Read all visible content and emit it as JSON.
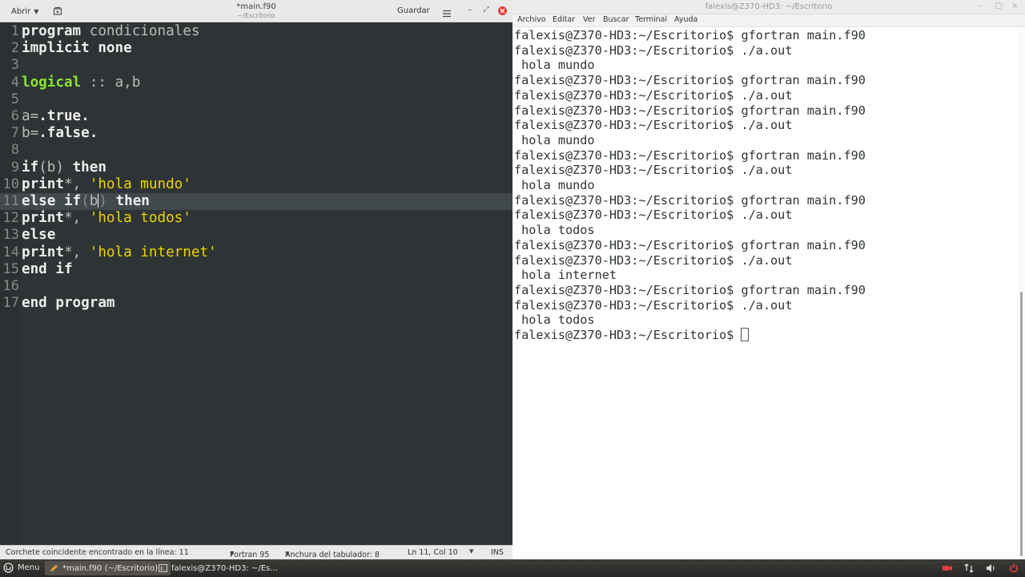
{
  "editor": {
    "open_label": "Abrir",
    "title": "*main.f90",
    "subtitle": "~/Escritorio",
    "save_label": "Guardar",
    "code_lines": [
      {
        "num": "1",
        "tokens": [
          {
            "t": "program",
            "c": "kw"
          },
          {
            "t": " condicionales",
            "c": "dim"
          }
        ]
      },
      {
        "num": "2",
        "tokens": [
          {
            "t": "implicit none",
            "c": "kw"
          }
        ]
      },
      {
        "num": "3",
        "tokens": []
      },
      {
        "num": "4",
        "tokens": [
          {
            "t": "logical",
            "c": "typ"
          },
          {
            "t": " :: a,b",
            "c": "dim"
          }
        ]
      },
      {
        "num": "5",
        "tokens": []
      },
      {
        "num": "6",
        "tokens": [
          {
            "t": "a=",
            "c": "dim"
          },
          {
            "t": ".true.",
            "c": "kw"
          }
        ]
      },
      {
        "num": "7",
        "tokens": [
          {
            "t": "b=",
            "c": "dim"
          },
          {
            "t": ".false.",
            "c": "kw"
          }
        ]
      },
      {
        "num": "8",
        "tokens": []
      },
      {
        "num": "9",
        "tokens": [
          {
            "t": "if",
            "c": "kw"
          },
          {
            "t": "(b) ",
            "c": "dim"
          },
          {
            "t": "then",
            "c": "kw"
          }
        ]
      },
      {
        "num": "10",
        "tokens": [
          {
            "t": "print",
            "c": "kw"
          },
          {
            "t": "*, ",
            "c": "dim"
          },
          {
            "t": "'hola mundo'",
            "c": "str"
          }
        ]
      },
      {
        "num": "11",
        "current": true,
        "tokens": [
          {
            "t": "else if",
            "c": "kw"
          },
          {
            "t": "(",
            "c": "paren"
          },
          {
            "t": "b",
            "c": "dim"
          },
          {
            "t": "CARET",
            "c": "caret"
          },
          {
            "t": ")",
            "c": "paren"
          },
          {
            "t": " ",
            "c": "dim"
          },
          {
            "t": "then",
            "c": "kw"
          }
        ]
      },
      {
        "num": "12",
        "tokens": [
          {
            "t": "print",
            "c": "kw"
          },
          {
            "t": "*, ",
            "c": "dim"
          },
          {
            "t": "'hola todos'",
            "c": "str"
          }
        ]
      },
      {
        "num": "13",
        "tokens": [
          {
            "t": "else",
            "c": "kw"
          }
        ]
      },
      {
        "num": "14",
        "tokens": [
          {
            "t": "print",
            "c": "kw"
          },
          {
            "t": "*, ",
            "c": "dim"
          },
          {
            "t": "'hola internet'",
            "c": "str"
          }
        ]
      },
      {
        "num": "15",
        "tokens": [
          {
            "t": "end if",
            "c": "kw"
          }
        ]
      },
      {
        "num": "16",
        "tokens": []
      },
      {
        "num": "17",
        "tokens": [
          {
            "t": "end program",
            "c": "kw"
          }
        ]
      }
    ],
    "status": {
      "message": "Corchete coincidente encontrado en la línea: 11",
      "language": "Fortran 95",
      "tab_width": "Anchura del tabulador: 8",
      "position": "Ln 11, Col 10",
      "mode": "INS"
    }
  },
  "terminal": {
    "title": "falexis@Z370-HD3: ~/Escritorio",
    "menu": [
      "Archivo",
      "Editar",
      "Ver",
      "Buscar",
      "Terminal",
      "Ayuda"
    ],
    "lines": [
      "falexis@Z370-HD3:~/Escritorio$ gfortran main.f90",
      "falexis@Z370-HD3:~/Escritorio$ ./a.out",
      " hola mundo",
      "falexis@Z370-HD3:~/Escritorio$ gfortran main.f90",
      "falexis@Z370-HD3:~/Escritorio$ ./a.out",
      "falexis@Z370-HD3:~/Escritorio$ gfortran main.f90",
      "falexis@Z370-HD3:~/Escritorio$ ./a.out",
      " hola mundo",
      "falexis@Z370-HD3:~/Escritorio$ gfortran main.f90",
      "falexis@Z370-HD3:~/Escritorio$ ./a.out",
      " hola mundo",
      "falexis@Z370-HD3:~/Escritorio$ gfortran main.f90",
      "falexis@Z370-HD3:~/Escritorio$ ./a.out",
      " hola todos",
      "falexis@Z370-HD3:~/Escritorio$ gfortran main.f90",
      "falexis@Z370-HD3:~/Escritorio$ ./a.out",
      " hola internet",
      "falexis@Z370-HD3:~/Escritorio$ gfortran main.f90",
      "falexis@Z370-HD3:~/Escritorio$ ./a.out",
      " hola todos"
    ],
    "prompt": "falexis@Z370-HD3:~/Escritorio$ "
  },
  "taskbar": {
    "menu_label": "Menu",
    "task_editor": "*main.f90 (~/Escritorio)...",
    "task_terminal": "falexis@Z370-HD3: ~/Es..."
  },
  "colors": {
    "editor_bg": "#2e3436",
    "keyword": "#eeeeec",
    "type": "#8ae234",
    "string": "#edd400",
    "close_button": "#e53935"
  }
}
